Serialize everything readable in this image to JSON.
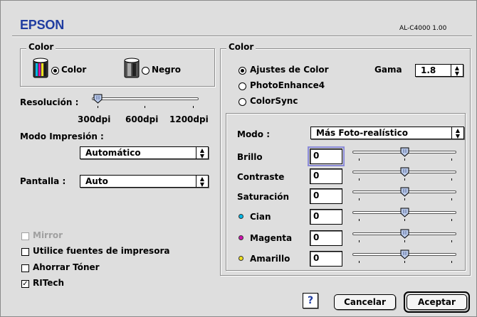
{
  "header": {
    "brand": "EPSON",
    "version": "AL-C4000  1.00"
  },
  "left": {
    "color_group": {
      "title": "Color",
      "options": [
        {
          "label": "Color",
          "selected": true
        },
        {
          "label": "Negro",
          "selected": false
        }
      ]
    },
    "resolution": {
      "label": "Resolución :",
      "ticks": [
        "300dpi",
        "600dpi",
        "1200dpi"
      ],
      "selected": "300dpi"
    },
    "print_mode": {
      "label": "Modo Impresión :",
      "value": "Automático"
    },
    "screen": {
      "label": "Pantalla :",
      "value": "Auto"
    },
    "checkboxes": [
      {
        "label": "Mirror",
        "checked": false,
        "enabled": false
      },
      {
        "label": "Utilice fuentes de impresora",
        "checked": false,
        "enabled": true
      },
      {
        "label": "Ahorrar Tóner",
        "checked": false,
        "enabled": true
      },
      {
        "label": "RITech",
        "checked": true,
        "enabled": true
      }
    ]
  },
  "right": {
    "title": "Color",
    "methods": [
      {
        "label": "Ajustes de Color",
        "selected": true
      },
      {
        "label": "PhotoEnhance4",
        "selected": false
      },
      {
        "label": "ColorSync",
        "selected": false
      }
    ],
    "gamma": {
      "label": "Gama",
      "value": "1.8"
    },
    "mode": {
      "label": "Modo :",
      "value": "Más Foto-realístico"
    },
    "sliders": [
      {
        "label": "Brillo",
        "value": "0",
        "dot": null
      },
      {
        "label": "Contraste",
        "value": "0",
        "dot": null
      },
      {
        "label": "Saturación",
        "value": "0",
        "dot": null
      },
      {
        "label": "Cian",
        "value": "0",
        "dot": "#00b8e8"
      },
      {
        "label": "Magenta",
        "value": "0",
        "dot": "#d010b0"
      },
      {
        "label": "Amarillo",
        "value": "0",
        "dot": "#f0e020"
      }
    ]
  },
  "buttons": {
    "help": "?",
    "cancel": "Cancelar",
    "accept": "Aceptar"
  },
  "colors": {
    "brand": "#1f3ca0",
    "dialog_bg": "#dedede"
  },
  "icons": {
    "color_printer": "color-cartridge-icon",
    "mono_printer": "mono-cartridge-icon",
    "help": "help-icon"
  }
}
